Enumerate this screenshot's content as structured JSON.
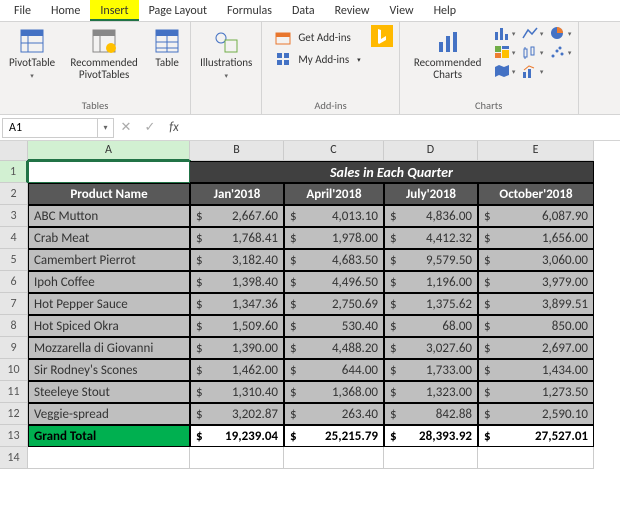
{
  "menu": {
    "file": "File",
    "home": "Home",
    "insert": "Insert",
    "pageLayout": "Page Layout",
    "formulas": "Formulas",
    "data": "Data",
    "review": "Review",
    "view": "View",
    "help": "Help"
  },
  "ribbon": {
    "tables": {
      "pivottable": "PivotTable",
      "recommended": "Recommended PivotTables",
      "table": "Table",
      "label": "Tables"
    },
    "illustrations": {
      "btn": "Illustrations"
    },
    "addins": {
      "get": "Get Add-ins",
      "my": "My Add-ins",
      "label": "Add-ins"
    },
    "charts": {
      "recommended": "Recommended Charts",
      "label": "Charts"
    }
  },
  "formulaBar": {
    "nameBox": "A1",
    "fx": "fx"
  },
  "cols": [
    "A",
    "B",
    "C",
    "D",
    "E"
  ],
  "chart_data": {
    "type": "table",
    "title": "Sales in Each Quarter",
    "columns": [
      "Product Name",
      "Jan'2018",
      "April'2018",
      "July'2018",
      "October'2018"
    ],
    "rows": [
      {
        "name": "ABC Mutton",
        "values": [
          2667.6,
          4013.1,
          4836.0,
          6087.9
        ]
      },
      {
        "name": "Crab Meat",
        "values": [
          1768.41,
          1978.0,
          4412.32,
          1656.0
        ]
      },
      {
        "name": "Camembert Pierrot",
        "values": [
          3182.4,
          4683.5,
          9579.5,
          3060.0
        ]
      },
      {
        "name": "Ipoh Coffee",
        "values": [
          1398.4,
          4496.5,
          1196.0,
          3979.0
        ]
      },
      {
        "name": "Hot Pepper Sauce",
        "values": [
          1347.36,
          2750.69,
          1375.62,
          3899.51
        ]
      },
      {
        "name": " Hot Spiced Okra",
        "values": [
          1509.6,
          530.4,
          68.0,
          850.0
        ]
      },
      {
        "name": "Mozzarella di Giovanni",
        "values": [
          1390.0,
          4488.2,
          3027.6,
          2697.0
        ]
      },
      {
        "name": "Sir Rodney's Scones",
        "values": [
          1462.0,
          644.0,
          1733.0,
          1434.0
        ]
      },
      {
        "name": "Steeleye Stout",
        "values": [
          1310.4,
          1368.0,
          1323.0,
          1273.5
        ]
      },
      {
        "name": "Veggie-spread",
        "values": [
          3202.87,
          263.4,
          842.88,
          2590.1
        ]
      }
    ],
    "totals": {
      "name": "Grand Total",
      "values": [
        19239.04,
        25215.79,
        28393.92,
        27527.01
      ]
    }
  },
  "display": {
    "title": "Sales in Each Quarter",
    "headers": [
      "Product Name",
      "Jan'2018",
      "April'2018",
      "July'2018",
      "October'2018"
    ],
    "rows": [
      [
        "ABC Mutton",
        "2,667.60",
        "4,013.10",
        "4,836.00",
        "6,087.90"
      ],
      [
        "Crab Meat",
        "1,768.41",
        "1,978.00",
        "4,412.32",
        "1,656.00"
      ],
      [
        "Camembert Pierrot",
        "3,182.40",
        "4,683.50",
        "9,579.50",
        "3,060.00"
      ],
      [
        "Ipoh Coffee",
        "1,398.40",
        "4,496.50",
        "1,196.00",
        "3,979.00"
      ],
      [
        "Hot Pepper Sauce",
        "1,347.36",
        "2,750.69",
        "1,375.62",
        "3,899.51"
      ],
      [
        " Hot Spiced Okra",
        "1,509.60",
        "530.40",
        "68.00",
        "850.00"
      ],
      [
        "Mozzarella di Giovanni",
        "1,390.00",
        "4,488.20",
        "3,027.60",
        "2,697.00"
      ],
      [
        "Sir Rodney's Scones",
        "1,462.00",
        "644.00",
        "1,733.00",
        "1,434.00"
      ],
      [
        "Steeleye Stout",
        "1,310.40",
        "1,368.00",
        "1,323.00",
        "1,273.50"
      ],
      [
        "Veggie-spread",
        "3,202.87",
        "263.40",
        "842.88",
        "2,590.10"
      ]
    ],
    "total": [
      "Grand Total",
      "19,239.04",
      "25,215.79",
      "28,393.92",
      "27,527.01"
    ],
    "currency": "$"
  }
}
